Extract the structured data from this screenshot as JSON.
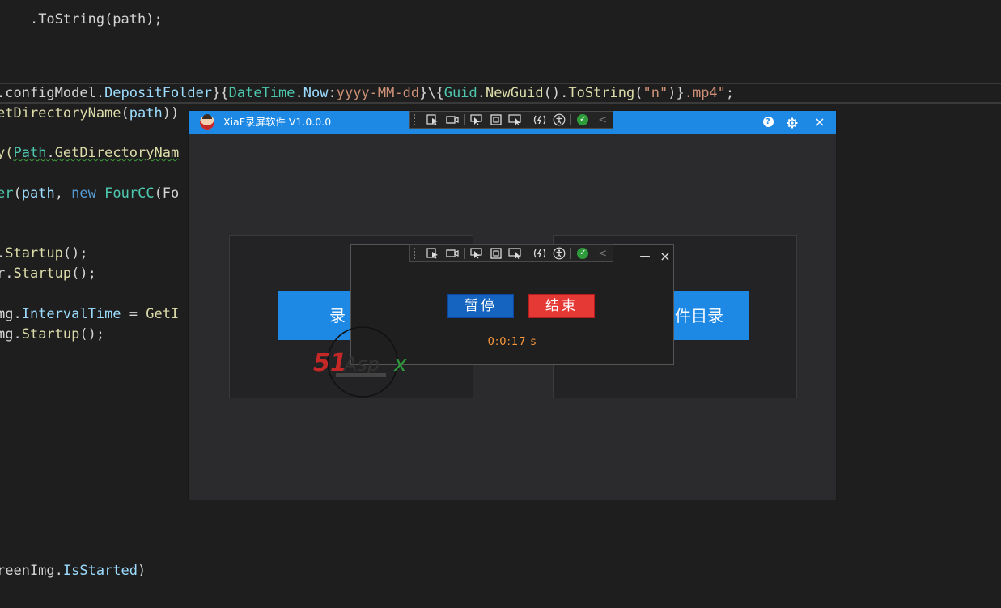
{
  "code": {
    "line_top": ".ToString(path);",
    "line1": {
      "a": ".configModel.",
      "b": "DepositFolder",
      "c": "}{",
      "d": "DateTime",
      "e": ".",
      "f": "Now",
      "g": ":",
      "h": "yyyy-MM-dd",
      "i": "}\\{",
      "j": "Guid",
      "k": ".",
      "l": "NewGuid",
      "m": "().",
      "n": "ToString",
      "o": "(",
      "p": "\"n\"",
      "q": ")}",
      "r": ".mp4\"",
      "s": ";"
    },
    "line2": {
      "a": "etDirectoryName",
      "b": "(",
      "c": "path",
      "d": "))"
    },
    "line3": {
      "a": "y(",
      "b": "Path",
      "c": ".",
      "d": "GetDirectoryNam"
    },
    "line4": {
      "a": "er",
      "b": "(",
      "c": "path",
      "d": ", ",
      "e": "new",
      "f": " ",
      "g": "FourCC",
      "h": "(Fo"
    },
    "line5": {
      "a": ".",
      "b": "Startup",
      "c": "();"
    },
    "line6": {
      "a": "r.",
      "b": "Startup",
      "c": "();"
    },
    "line7": {
      "a": "mg.",
      "b": "IntervalTime",
      "c": " = ",
      "d": "GetI"
    },
    "line8": {
      "a": "mg.",
      "b": "Startup",
      "c": "();"
    },
    "line9": {
      "a": "reenImg.",
      "b": "IsStarted",
      "c": ")"
    }
  },
  "window": {
    "title": "XiaF录屏软件 V1.0.0.0",
    "help_label": "?",
    "settings_label": "⚙",
    "close_label": "×"
  },
  "cards": {
    "left_button_label": "录",
    "right_button_label": "件目录"
  },
  "recorder": {
    "pause_label": "暂停",
    "stop_label": "结束",
    "timer": "0:0:17 s",
    "minimize_label": "—",
    "close_label": "×"
  },
  "toolbar": {
    "icons": [
      "select-element-icon",
      "video-record-icon",
      "pointer-select-icon",
      "frame-icon",
      "screen-select-icon",
      "hot-reload-icon",
      "accessibility-icon",
      "check-icon",
      "collapse-icon"
    ],
    "check_label": "✓",
    "collapse_label": "<"
  },
  "watermark": {
    "brand": "51Aspx"
  },
  "colors": {
    "accent": "#1e88e5",
    "stop": "#e53935",
    "timer": "#ff9a3c",
    "editor_bg": "#1e1e1e"
  }
}
